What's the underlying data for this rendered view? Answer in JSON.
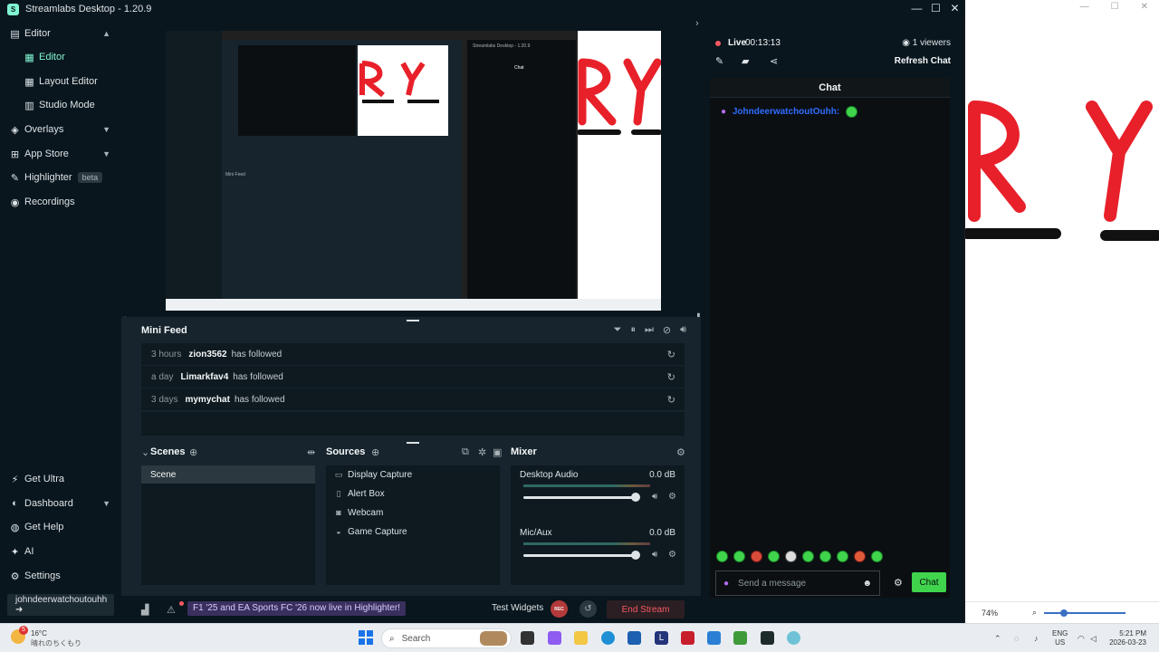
{
  "window": {
    "title": "Streamlabs Desktop - 1.20.9",
    "controls": [
      "—",
      "☐",
      "✕"
    ]
  },
  "sidebar": {
    "items": [
      {
        "label": "Editor",
        "icon": "editor-icon"
      },
      {
        "label": "Editor",
        "icon": "editor-sub-icon"
      },
      {
        "label": "Layout Editor",
        "icon": "layout-editor-icon"
      },
      {
        "label": "Studio Mode",
        "icon": "studio-mode-icon"
      },
      {
        "label": "Overlays",
        "icon": "overlays-icon"
      },
      {
        "label": "App Store",
        "icon": "app-store-icon"
      },
      {
        "label": "Highlighter",
        "icon": "highlighter-icon",
        "badge": "beta"
      },
      {
        "label": "Recordings",
        "icon": "recordings-icon"
      }
    ],
    "bottom_items": [
      {
        "label": "Get Ultra",
        "icon": "ultra-icon"
      },
      {
        "label": "Dashboard",
        "icon": "dashboard-icon"
      },
      {
        "label": "Get Help",
        "icon": "help-icon"
      },
      {
        "label": "AI",
        "icon": "ai-icon"
      },
      {
        "label": "Settings",
        "icon": "settings-icon"
      }
    ],
    "user": "johndeerwatchoutouhh ➜"
  },
  "preview": {
    "nested_title": "Streamlabs Desktop - 1.20.9",
    "nested_minifeed": "Mini Feed",
    "nested_chat": "Chat"
  },
  "minifeed": {
    "title": "Mini Feed",
    "rows": [
      {
        "time": "3 hours",
        "user": "zion3562",
        "action": "has followed"
      },
      {
        "time": "a day",
        "user": "Limarkfav4",
        "action": "has followed"
      },
      {
        "time": "3 days",
        "user": "mymychat",
        "action": "has followed"
      }
    ]
  },
  "scenes": {
    "title": "Scenes",
    "items": [
      "Scene"
    ]
  },
  "sources": {
    "title": "Sources",
    "items": [
      {
        "label": "Display Capture",
        "icon": "monitor-icon"
      },
      {
        "label": "Alert Box",
        "icon": "alert-box-icon"
      },
      {
        "label": "Webcam",
        "icon": "webcam-icon"
      },
      {
        "label": "Game Capture",
        "icon": "gamepad-icon"
      }
    ]
  },
  "mixer": {
    "title": "Mixer",
    "channels": [
      {
        "name": "Desktop Audio",
        "db": "0.0 dB",
        "level": 1.0
      },
      {
        "name": "Mic/Aux",
        "db": "0.0 dB",
        "level": 1.0
      }
    ]
  },
  "footer": {
    "announcement": "F1 '25 and EA Sports FC '26 now live in Highlighter!",
    "test_widgets": "Test Widgets",
    "rec": "REC",
    "end_stream": "End Stream"
  },
  "stream": {
    "live_label": "Live",
    "live_time": "00:13:13",
    "viewers": "1 viewers",
    "refresh_chat": "Refresh Chat"
  },
  "chat": {
    "title": "Chat",
    "messages": [
      {
        "user": "JohndeerwatchoutOuhh",
        "separator": ":"
      }
    ],
    "placeholder": "Send a message",
    "send_label": "Chat"
  },
  "bg_window": {
    "zoom": "74%"
  },
  "taskbar": {
    "weather_temp": "16°C",
    "weather_desc": "晴れのちくもり",
    "weather_badge": "5",
    "search_placeholder": "Search",
    "lang_line1": "ENG",
    "lang_line2": "US",
    "time": "5:21 PM",
    "date": "2026-03-23"
  },
  "colors": {
    "accent": "#80f5d2",
    "live": "#f85961",
    "chat_send": "#3fd44c"
  }
}
